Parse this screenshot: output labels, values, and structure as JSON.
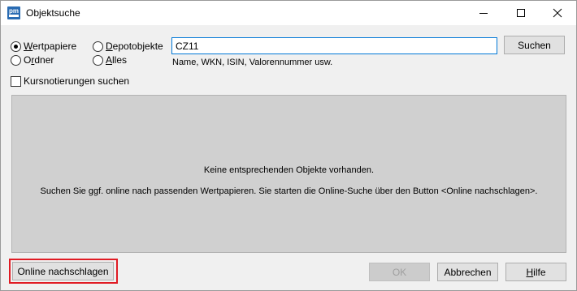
{
  "window": {
    "title": "Objektsuche",
    "app_icon_text": "pm"
  },
  "search_type": {
    "options": [
      {
        "id": "wertpapiere",
        "label_underlined": "W",
        "label_rest": "ertpapiere",
        "checked": true
      },
      {
        "id": "depotobjekte",
        "label_underlined": "D",
        "label_rest": "epotobjekte",
        "checked": false
      },
      {
        "id": "ordner",
        "label_prefix": "O",
        "label_underlined": "r",
        "label_rest": "dner",
        "checked": false
      },
      {
        "id": "alles",
        "label_underlined": "A",
        "label_rest": "lles",
        "checked": false
      }
    ]
  },
  "search": {
    "value": "CZ11",
    "hint": "Name, WKN, ISIN, Valorennummer usw.",
    "button_label": "Suchen"
  },
  "kurs_checkbox": {
    "label": "Kursnotierungen suchen",
    "checked": false
  },
  "results": {
    "message_1": "Keine entsprechenden Objekte vorhanden.",
    "message_2": "Suchen Sie ggf. online nach passenden Wertpapieren. Sie starten die Online-Suche über den Button <Online nachschlagen>."
  },
  "footer": {
    "online_button": "Online nachschlagen",
    "ok_button": "OK",
    "cancel_button": "Abbrechen",
    "help_underlined": "H",
    "help_rest": "ilfe"
  },
  "colors": {
    "highlight": "#e01b24",
    "focus": "#0078d7"
  }
}
